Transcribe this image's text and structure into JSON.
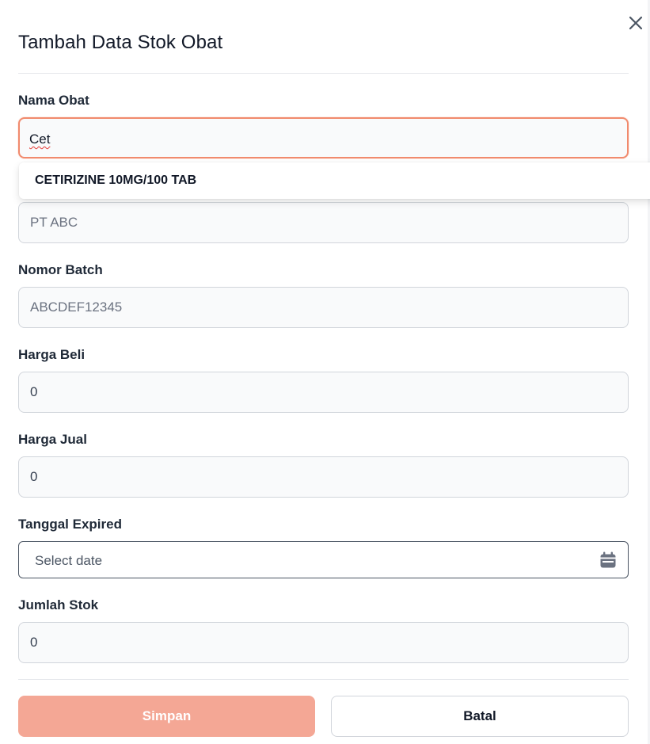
{
  "modal": {
    "title": "Tambah Data Stok Obat"
  },
  "fields": {
    "nama_obat": {
      "label": "Nama Obat",
      "value": "Cet"
    },
    "supplier": {
      "placeholder": "PT ABC"
    },
    "nomor_batch": {
      "label": "Nomor Batch",
      "placeholder": "ABCDEF12345"
    },
    "harga_beli": {
      "label": "Harga Beli",
      "value": "0"
    },
    "harga_jual": {
      "label": "Harga Jual",
      "value": "0"
    },
    "tanggal_expired": {
      "label": "Tanggal Expired",
      "placeholder": "Select date"
    },
    "jumlah_stok": {
      "label": "Jumlah Stok",
      "value": "0"
    }
  },
  "autocomplete": {
    "items": [
      "CETIRIZINE 10MG/100 TAB"
    ]
  },
  "buttons": {
    "save": "Simpan",
    "cancel": "Batal"
  },
  "colors": {
    "accent": "#f18a6d",
    "save_button": "#f4a795"
  },
  "icons": {
    "close": "close-icon",
    "calendar": "calendar-icon"
  }
}
